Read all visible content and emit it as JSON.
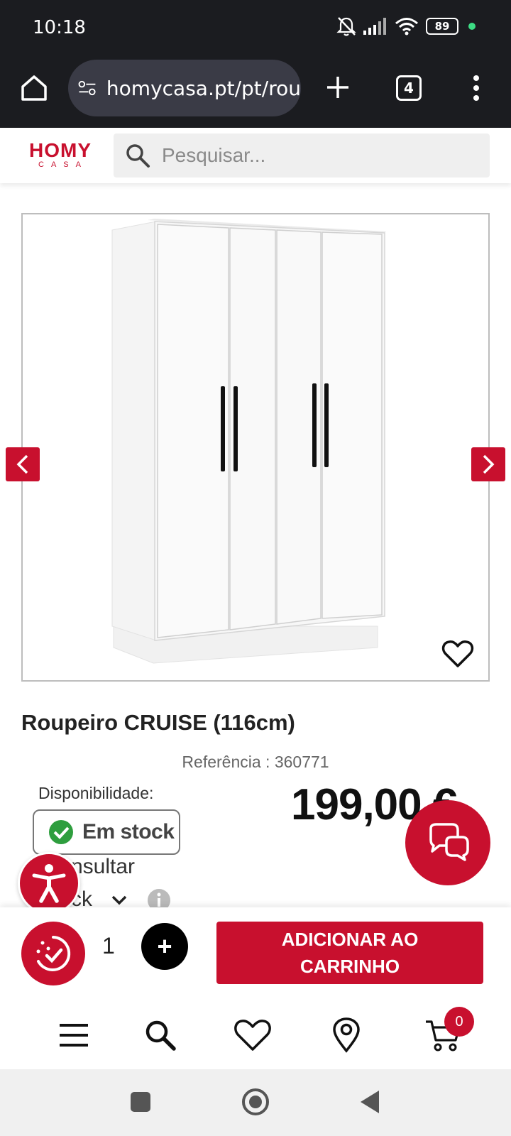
{
  "status_bar": {
    "time": "10:18",
    "battery": "89"
  },
  "browser": {
    "url": "homycasa.pt/pt/rou",
    "tab_count": "4"
  },
  "header": {
    "logo_main": "HOMY",
    "logo_sub": "CASA",
    "search_placeholder": "Pesquisar..."
  },
  "product": {
    "title": "Roupeiro CRUISE (116cm)",
    "reference": "Referência : 360771",
    "availability_label": "Disponibilidade:",
    "stock_status": "Em stock",
    "consult_line1": "nsultar",
    "consult_line2": "ck",
    "price": "199,00 €"
  },
  "cart_bar": {
    "quantity": "1",
    "plus": "+",
    "add_to_cart": "ADICIONAR AO CARRINHO"
  },
  "bottom_nav": {
    "cart_count": "0"
  },
  "colors": {
    "brand_red": "#c8102e",
    "stock_green": "#2e9e3e"
  }
}
